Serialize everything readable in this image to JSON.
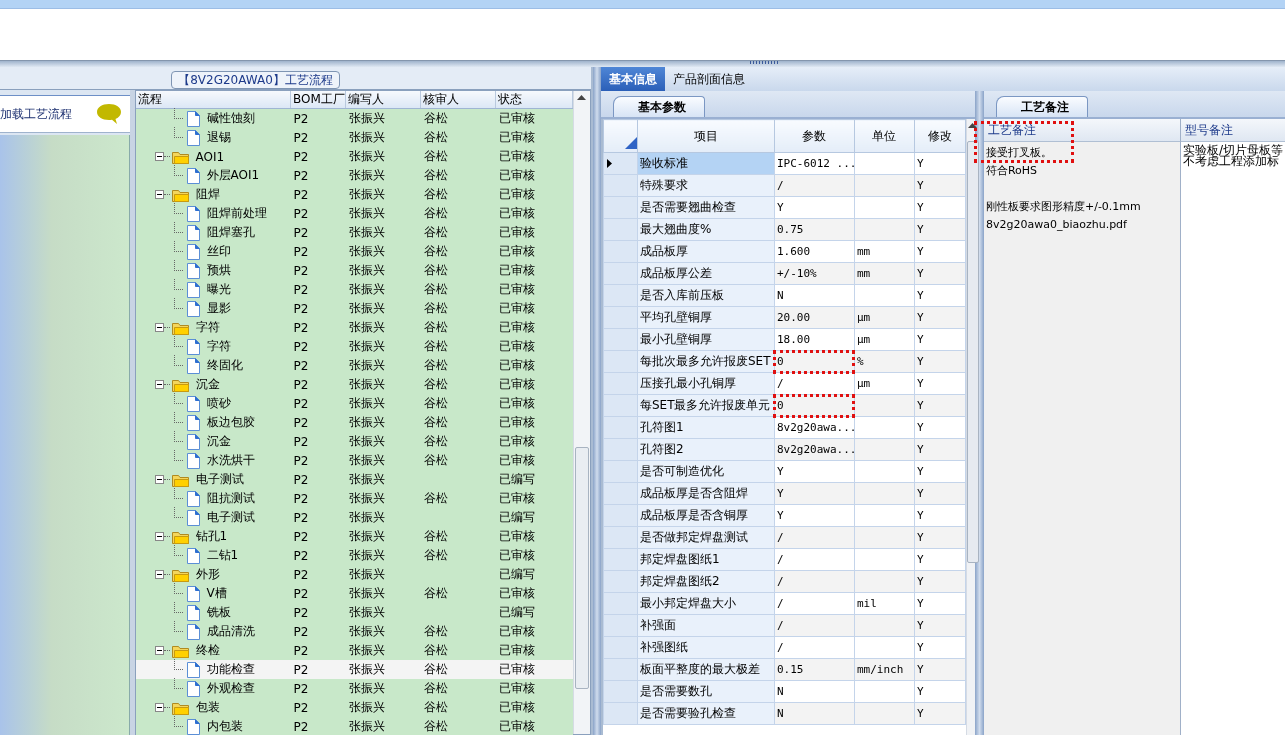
{
  "process_group": {
    "title": "【8V2G20AWA0】工艺流程"
  },
  "left_panel": {
    "message": "加载工艺流程"
  },
  "tree": {
    "columns": [
      "流程",
      "BOM工厂",
      "编写人",
      "核审人",
      "状态"
    ],
    "continued_items": [
      {
        "name": "碱性蚀刻",
        "factory": "P2",
        "writer": "张振兴",
        "reviewer": "谷松",
        "status": "已审核",
        "selected": false
      },
      {
        "name": "退锡",
        "factory": "P2",
        "writer": "张振兴",
        "reviewer": "谷松",
        "status": "已审核",
        "selected": false
      }
    ],
    "items": [
      {
        "name": "AOI1",
        "factory": "P2",
        "writer": "张振兴",
        "reviewer": "谷松",
        "status": "已审核",
        "expanded": true,
        "selected": false,
        "children": [
          {
            "name": "外层AOI1",
            "factory": "P2",
            "writer": "张振兴",
            "reviewer": "谷松",
            "status": "已审核",
            "selected": false
          }
        ]
      },
      {
        "name": "阻焊",
        "factory": "P2",
        "writer": "张振兴",
        "reviewer": "谷松",
        "status": "已审核",
        "expanded": true,
        "selected": false,
        "children": [
          {
            "name": "阻焊前处理",
            "factory": "P2",
            "writer": "张振兴",
            "reviewer": "谷松",
            "status": "已审核",
            "selected": false
          },
          {
            "name": "阻焊塞孔",
            "factory": "P2",
            "writer": "张振兴",
            "reviewer": "谷松",
            "status": "已审核",
            "selected": false
          },
          {
            "name": "丝印",
            "factory": "P2",
            "writer": "张振兴",
            "reviewer": "谷松",
            "status": "已审核",
            "selected": false
          },
          {
            "name": "预烘",
            "factory": "P2",
            "writer": "张振兴",
            "reviewer": "谷松",
            "status": "已审核",
            "selected": false
          },
          {
            "name": "曝光",
            "factory": "P2",
            "writer": "张振兴",
            "reviewer": "谷松",
            "status": "已审核",
            "selected": false
          },
          {
            "name": "显影",
            "factory": "P2",
            "writer": "张振兴",
            "reviewer": "谷松",
            "status": "已审核",
            "selected": false
          }
        ]
      },
      {
        "name": "字符",
        "factory": "P2",
        "writer": "张振兴",
        "reviewer": "谷松",
        "status": "已审核",
        "expanded": true,
        "selected": false,
        "children": [
          {
            "name": "字符",
            "factory": "P2",
            "writer": "张振兴",
            "reviewer": "谷松",
            "status": "已审核",
            "selected": false
          },
          {
            "name": "终固化",
            "factory": "P2",
            "writer": "张振兴",
            "reviewer": "谷松",
            "status": "已审核",
            "selected": false
          }
        ]
      },
      {
        "name": "沉金",
        "factory": "P2",
        "writer": "张振兴",
        "reviewer": "谷松",
        "status": "已审核",
        "expanded": true,
        "selected": false,
        "children": [
          {
            "name": "喷砂",
            "factory": "P2",
            "writer": "张振兴",
            "reviewer": "谷松",
            "status": "已审核",
            "selected": false
          },
          {
            "name": "板边包胶",
            "factory": "P2",
            "writer": "张振兴",
            "reviewer": "谷松",
            "status": "已审核",
            "selected": false
          },
          {
            "name": "沉金",
            "factory": "P2",
            "writer": "张振兴",
            "reviewer": "谷松",
            "status": "已审核",
            "selected": false
          },
          {
            "name": "水洗烘干",
            "factory": "P2",
            "writer": "张振兴",
            "reviewer": "谷松",
            "status": "已审核",
            "selected": false
          }
        ]
      },
      {
        "name": "电子测试",
        "factory": "P2",
        "writer": "张振兴",
        "status": "已编写",
        "expanded": true,
        "selected": false,
        "children": [
          {
            "name": "阻抗测试",
            "factory": "P2",
            "writer": "张振兴",
            "reviewer": "谷松",
            "status": "已审核",
            "selected": false
          },
          {
            "name": "电子测试",
            "factory": "P2",
            "writer": "张振兴",
            "status": "已编写",
            "selected": false
          }
        ]
      },
      {
        "name": "钻孔1",
        "factory": "P2",
        "writer": "张振兴",
        "reviewer": "谷松",
        "status": "已审核",
        "expanded": true,
        "selected": false,
        "children": [
          {
            "name": "二钻1",
            "factory": "P2",
            "writer": "张振兴",
            "reviewer": "谷松",
            "status": "已审核",
            "selected": false
          }
        ]
      },
      {
        "name": "外形",
        "factory": "P2",
        "writer": "张振兴",
        "status": "已编写",
        "expanded": true,
        "selected": false,
        "children": [
          {
            "name": "V槽",
            "factory": "P2",
            "writer": "张振兴",
            "reviewer": "谷松",
            "status": "已审核",
            "selected": false
          },
          {
            "name": "铣板",
            "factory": "P2",
            "writer": "张振兴",
            "status": "已编写",
            "selected": false
          },
          {
            "name": "成品清洗",
            "factory": "P2",
            "writer": "张振兴",
            "reviewer": "谷松",
            "status": "已审核",
            "selected": false
          }
        ]
      },
      {
        "name": "终检",
        "factory": "P2",
        "writer": "张振兴",
        "reviewer": "谷松",
        "status": "已审核",
        "expanded": true,
        "selected": false,
        "children": [
          {
            "name": "功能检查",
            "factory": "P2",
            "writer": "张振兴",
            "reviewer": "谷松",
            "status": "已审核",
            "selected": true
          },
          {
            "name": "外观检查",
            "factory": "P2",
            "writer": "张振兴",
            "reviewer": "谷松",
            "status": "已审核",
            "selected": false
          }
        ]
      },
      {
        "name": "包装",
        "factory": "P2",
        "writer": "张振兴",
        "reviewer": "谷松",
        "status": "已审核",
        "expanded": true,
        "selected": false,
        "children": [
          {
            "name": "内包装",
            "factory": "P2",
            "writer": "张振兴",
            "reviewer": "谷松",
            "status": "已审核",
            "selected": false
          }
        ]
      }
    ]
  },
  "tabs": [
    {
      "label": "基本信息",
      "selected": true
    },
    {
      "label": "产品剖面信息",
      "selected": false
    }
  ],
  "params": {
    "tab": "基本参数",
    "columns": [
      "项目",
      "参数",
      "单位",
      "修改"
    ],
    "rows": [
      {
        "item": "验收标准",
        "value": "IPC-6012 ...",
        "modified": "Y",
        "current": true,
        "marked": false
      },
      {
        "item": "特殊要求",
        "value": "/",
        "modified": "Y",
        "current": false,
        "marked": false
      },
      {
        "item": "是否需要翘曲检查",
        "value": "Y",
        "modified": "Y",
        "current": false,
        "marked": false
      },
      {
        "item": "最大翘曲度%",
        "value": "0.75",
        "modified": "Y",
        "current": false,
        "marked": false
      },
      {
        "item": "成品板厚",
        "value": "1.600",
        "unit": "mm",
        "modified": "Y",
        "current": false,
        "marked": false
      },
      {
        "item": "成品板厚公差",
        "value": "+/-10%",
        "unit": "mm",
        "modified": "Y",
        "current": false,
        "marked": false
      },
      {
        "item": "是否入库前压板",
        "value": "N",
        "modified": "Y",
        "current": false,
        "marked": false
      },
      {
        "item": "平均孔壁铜厚",
        "value": "20.00",
        "unit": "μm",
        "modified": "Y",
        "current": false,
        "marked": false
      },
      {
        "item": "最小孔壁铜厚",
        "value": "18.00",
        "unit": "μm",
        "modified": "Y",
        "current": false,
        "marked": false
      },
      {
        "item": "每批次最多允许报废SET",
        "value": "0",
        "unit": "%",
        "modified": "Y",
        "current": false,
        "marked": true
      },
      {
        "item": "压接孔最小孔铜厚",
        "value": "/",
        "unit": "μm",
        "modified": "Y",
        "current": false,
        "marked": false
      },
      {
        "item": "每SET最多允许报废单元",
        "value": "0",
        "modified": "Y",
        "current": false,
        "marked": true
      },
      {
        "item": "孔符图1",
        "value": "8v2g20awa...",
        "modified": "Y",
        "current": false,
        "marked": false
      },
      {
        "item": "孔符图2",
        "value": "8v2g20awa...",
        "modified": "Y",
        "current": false,
        "marked": false
      },
      {
        "item": "是否可制造优化",
        "value": "Y",
        "modified": "Y",
        "current": false,
        "marked": false
      },
      {
        "item": "成品板厚是否含阻焊",
        "value": "Y",
        "modified": "Y",
        "current": false,
        "marked": false
      },
      {
        "item": "成品板厚是否含铜厚",
        "value": "Y",
        "modified": "Y",
        "current": false,
        "marked": false
      },
      {
        "item": "是否做邦定焊盘测试",
        "value": "/",
        "modified": "Y",
        "current": false,
        "marked": false
      },
      {
        "item": "邦定焊盘图纸1",
        "value": "/",
        "modified": "Y",
        "current": false,
        "marked": false
      },
      {
        "item": "邦定焊盘图纸2",
        "value": "/",
        "modified": "Y",
        "current": false,
        "marked": false
      },
      {
        "item": "最小邦定焊盘大小",
        "value": "/",
        "unit": "mil",
        "modified": "Y",
        "current": false,
        "marked": false
      },
      {
        "item": "补强面",
        "value": "/",
        "modified": "Y",
        "current": false,
        "marked": false
      },
      {
        "item": "补强图纸",
        "value": "/",
        "modified": "Y",
        "current": false,
        "marked": false
      },
      {
        "item": "板面平整度的最大极差",
        "value": "0.15",
        "unit": "mm/inch",
        "modified": "Y",
        "current": false,
        "marked": false
      },
      {
        "item": "是否需要数孔",
        "value": "N",
        "modified": "Y",
        "current": false,
        "marked": false
      },
      {
        "item": "是否需要验孔检查",
        "value": "N",
        "modified": "Y",
        "current": false,
        "marked": false
      }
    ]
  },
  "remarks": {
    "tab": "工艺备注",
    "process": {
      "heading": "工艺备注",
      "marked": true,
      "paragraphs": [
        {
          "lines": [
            "接受打叉板。",
            "符合RoHS"
          ]
        },
        {
          "lines": [
            "刚性板要求图形精度+/-0.1mm",
            "8v2g20awa0_biaozhu.pdf"
          ]
        }
      ]
    },
    "model": {
      "heading": "型号备注",
      "lines": [
        "实验板/切片母板等",
        "不考虑工程添加标"
      ]
    }
  }
}
